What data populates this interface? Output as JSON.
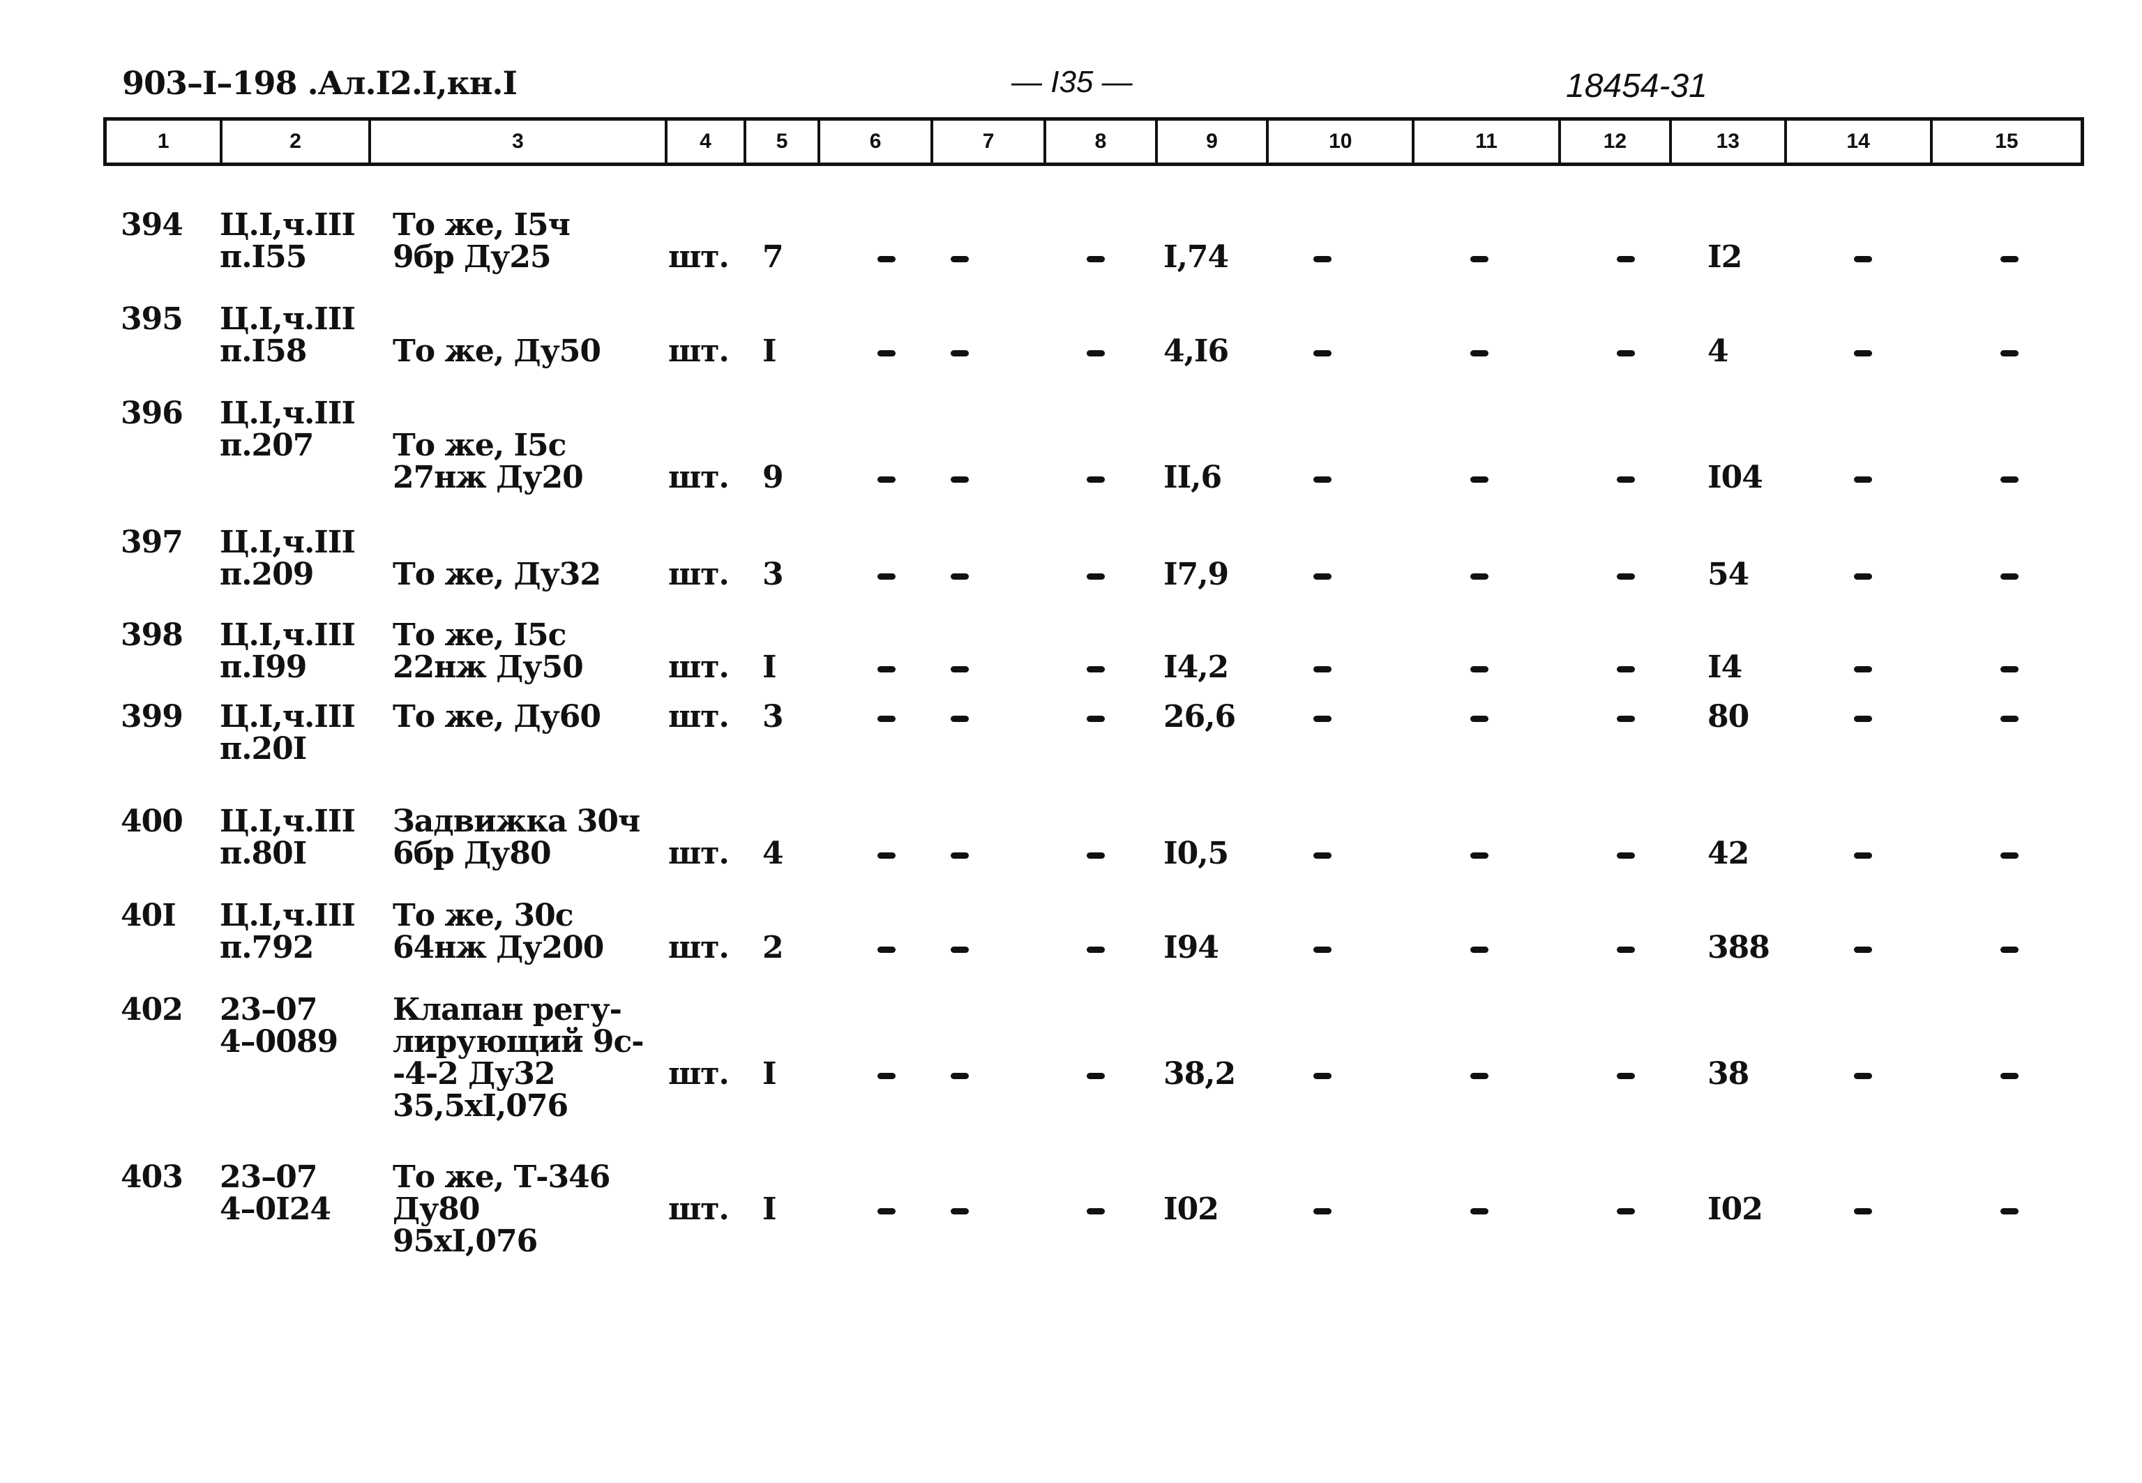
{
  "header": {
    "doc_code": "903–I–198 .Ал.I2.I,кн.I",
    "page_number": "— I35 —",
    "archive_number": "18454-31"
  },
  "columns": [
    "1",
    "2",
    "3",
    "4",
    "5",
    "6",
    "7",
    "8",
    "9",
    "10",
    "11",
    "12",
    "13",
    "14",
    "15"
  ],
  "rows": [
    {
      "num": "394",
      "ref": "Ц.I,ч.III\nп.I55",
      "name": "То же, I5ч\n9бр Ду25",
      "unit": "шт.",
      "qty": "7",
      "c6": "–",
      "c7": "–",
      "c8": "–",
      "c9": "I,74",
      "c10": "–",
      "c11": "–",
      "c12": "–",
      "c13": "I2",
      "c14": "–",
      "c15": "–"
    },
    {
      "num": "395",
      "ref": "Ц.I,ч.III\nп.I58",
      "name": "\nТо же, Ду50",
      "unit": "шт.",
      "qty": "I",
      "c6": "–",
      "c7": "–",
      "c8": "–",
      "c9": "4,I6",
      "c10": "–",
      "c11": "–",
      "c12": "–",
      "c13": "4",
      "c14": "–",
      "c15": "–"
    },
    {
      "num": "396",
      "ref": "Ц.I,ч.III\nп.207",
      "name": "\nТо же, I5с\n27нж Ду20",
      "unit": "шт.",
      "qty": "9",
      "c6": "–",
      "c7": "–",
      "c8": "–",
      "c9": "II,6",
      "c10": "–",
      "c11": "–",
      "c12": "–",
      "c13": "I04",
      "c14": "–",
      "c15": "–"
    },
    {
      "num": "397",
      "ref": "Ц.I,ч.III\nп.209",
      "name": "\nТо же, Ду32",
      "unit": "шт.",
      "qty": "3",
      "c6": "–",
      "c7": "–",
      "c8": "–",
      "c9": "I7,9",
      "c10": "–",
      "c11": "–",
      "c12": "–",
      "c13": "54",
      "c14": "–",
      "c15": "–"
    },
    {
      "num": "398",
      "ref": "Ц.I,ч.III\nп.I99",
      "name": "То же, I5с\n22нж Ду50",
      "unit": "шт.",
      "qty": "I",
      "c6": "–",
      "c7": "–",
      "c8": "–",
      "c9": "I4,2",
      "c10": "–",
      "c11": "–",
      "c12": "–",
      "c13": "I4",
      "c14": "–",
      "c15": "–"
    },
    {
      "num": "399",
      "ref": "Ц.I,ч.III\nп.20I",
      "name": "То же, Ду60",
      "unit": "шт.",
      "qty": "3",
      "c6": "–",
      "c7": "–",
      "c8": "–",
      "c9": "26,6",
      "c10": "–",
      "c11": "–",
      "c12": "–",
      "c13": "80",
      "c14": "–",
      "c15": "–"
    },
    {
      "num": "400",
      "ref": "Ц.I,ч.III\nп.80I",
      "name": "Задвижка 30ч\n6бр Ду80",
      "unit": "шт.",
      "qty": "4",
      "c6": "–",
      "c7": "–",
      "c8": "–",
      "c9": "I0,5",
      "c10": "–",
      "c11": "–",
      "c12": "–",
      "c13": "42",
      "c14": "–",
      "c15": "–"
    },
    {
      "num": "40I",
      "ref": "Ц.I,ч.III\nп.792",
      "name": "То же, 30с\n64нж Ду200",
      "unit": "шт.",
      "qty": "2",
      "c6": "–",
      "c7": "–",
      "c8": "–",
      "c9": "I94",
      "c10": "–",
      "c11": "–",
      "c12": "–",
      "c13": "388",
      "c14": "–",
      "c15": "–"
    },
    {
      "num": "402",
      "ref": "23–07\n4–0089",
      "name": "Клапан регу-\nлирующий 9с-\n-4-2 Ду32\n35,5хI,076",
      "unit": "шт.",
      "qty": "I",
      "c6": "–",
      "c7": "–",
      "c8": "–",
      "c9": "38,2",
      "c10": "–",
      "c11": "–",
      "c12": "–",
      "c13": "38",
      "c14": "–",
      "c15": "–"
    },
    {
      "num": "403",
      "ref": "23–07\n4–0I24",
      "name": "То же, Т-346\nДу80\n95хI,076",
      "unit": "шт.",
      "qty": "I",
      "c6": "–",
      "c7": "–",
      "c8": "–",
      "c9": "I02",
      "c10": "–",
      "c11": "–",
      "c12": "–",
      "c13": "I02",
      "c14": "–",
      "c15": "–"
    }
  ]
}
